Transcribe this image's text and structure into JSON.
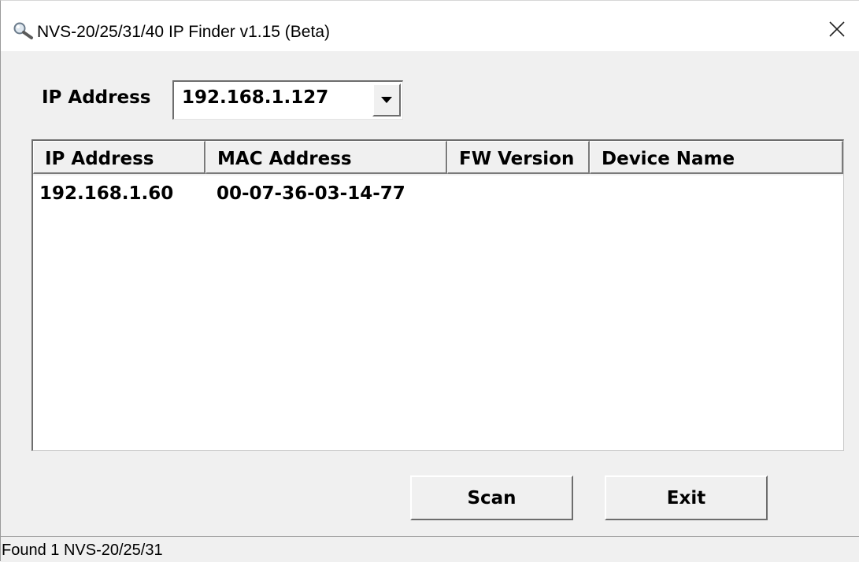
{
  "window": {
    "title": "NVS-20/25/31/40 IP Finder v1.15 (Beta)",
    "title_icon": "magnifier-icon",
    "close_icon": "close-icon",
    "close_glyph": "✕"
  },
  "form": {
    "ip_label": "IP Address",
    "ip_value": "192.168.1.127",
    "dropdown_icon": "chevron-down-icon"
  },
  "table": {
    "columns": [
      "IP Address",
      "MAC Address",
      "FW Version",
      "Device Name"
    ],
    "rows": [
      {
        "ip": "192.168.1.60",
        "mac": "00-07-36-03-14-77",
        "fw": "",
        "name": ""
      }
    ]
  },
  "buttons": {
    "scan_label": "Scan",
    "exit_label": "Exit"
  },
  "status": {
    "text": "Found 1 NVS-20/25/31"
  },
  "colors": {
    "window_bg": "#f0f0f0",
    "titlebar_bg": "#ffffff",
    "list_bg": "#ffffff"
  }
}
